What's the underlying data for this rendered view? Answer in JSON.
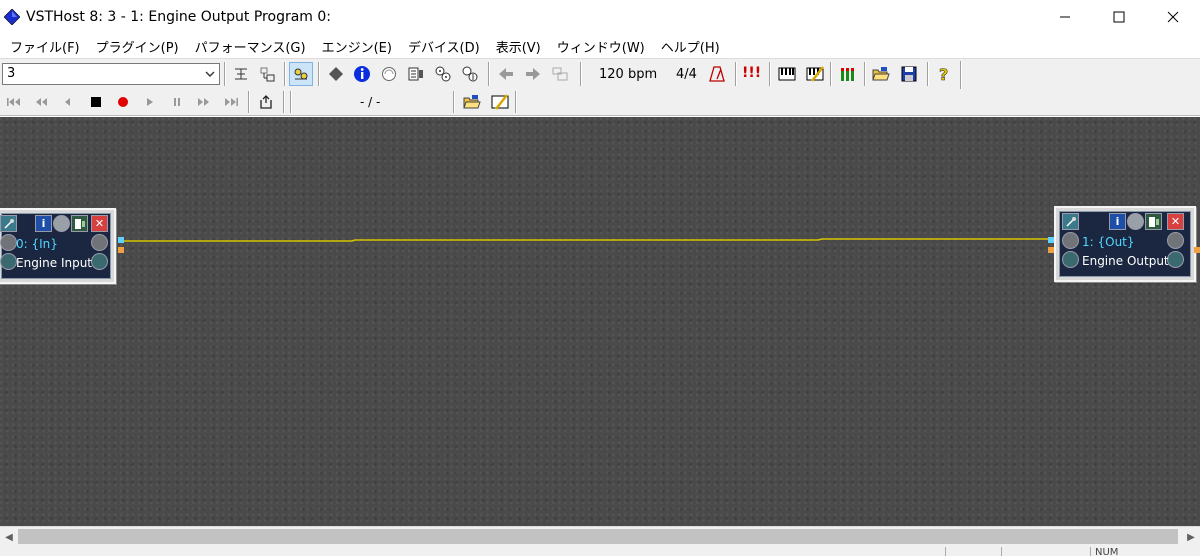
{
  "window": {
    "title": "VSTHost 8: 3 - 1: Engine Output Program 0:",
    "minimize_glyph": "—",
    "maximize_glyph": "☐",
    "close_glyph": "✕"
  },
  "menu": {
    "items": [
      {
        "label": "ファイル(F)"
      },
      {
        "label": "プラグイン(P)"
      },
      {
        "label": "パフォーマンス(G)"
      },
      {
        "label": "エンジン(E)"
      },
      {
        "label": "デバイス(D)"
      },
      {
        "label": "表示(V)"
      },
      {
        "label": "ウィンドウ(W)"
      },
      {
        "label": "ヘルプ(H)"
      }
    ]
  },
  "toolbar": {
    "performance_select": "3",
    "tempo": "120 bpm",
    "time_signature": "4/4",
    "meter_text": "!!!"
  },
  "transport": {
    "position": "- / -"
  },
  "plugins": [
    {
      "id_label": "0: {In}",
      "name": "Engine Input",
      "info_glyph": "i",
      "close_glyph": "✕"
    },
    {
      "id_label": "1: {Out}",
      "name": "Engine Output",
      "info_glyph": "i",
      "close_glyph": "✕"
    }
  ],
  "statusbar": {
    "cell1": "",
    "cell2": "",
    "num": "NUM"
  },
  "colors": {
    "canvas": "#4a4a4a",
    "wire": "#d8c300",
    "plugin_label": "#4fd8ff"
  }
}
